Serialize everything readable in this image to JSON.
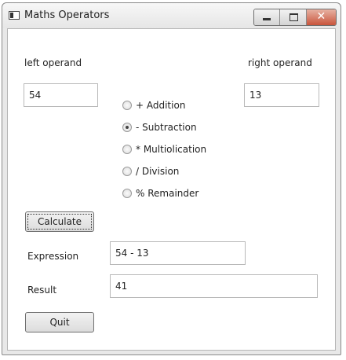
{
  "window": {
    "title": "Maths Operators"
  },
  "form": {
    "left_operand_label": "left operand",
    "right_operand_label": "right operand",
    "left_operand_value": "54",
    "right_operand_value": "13",
    "operators": [
      {
        "label": "+ Addition",
        "checked": false
      },
      {
        "label": "- Subtraction",
        "checked": true
      },
      {
        "label": "* Multiolication",
        "checked": false
      },
      {
        "label": "/ Division",
        "checked": false
      },
      {
        "label": "% Remainder",
        "checked": false
      }
    ],
    "calculate_label": "Calculate",
    "expression_label": "Expression",
    "expression_value": "54 - 13",
    "result_label": "Result",
    "result_value": "41",
    "quit_label": "Quit"
  }
}
